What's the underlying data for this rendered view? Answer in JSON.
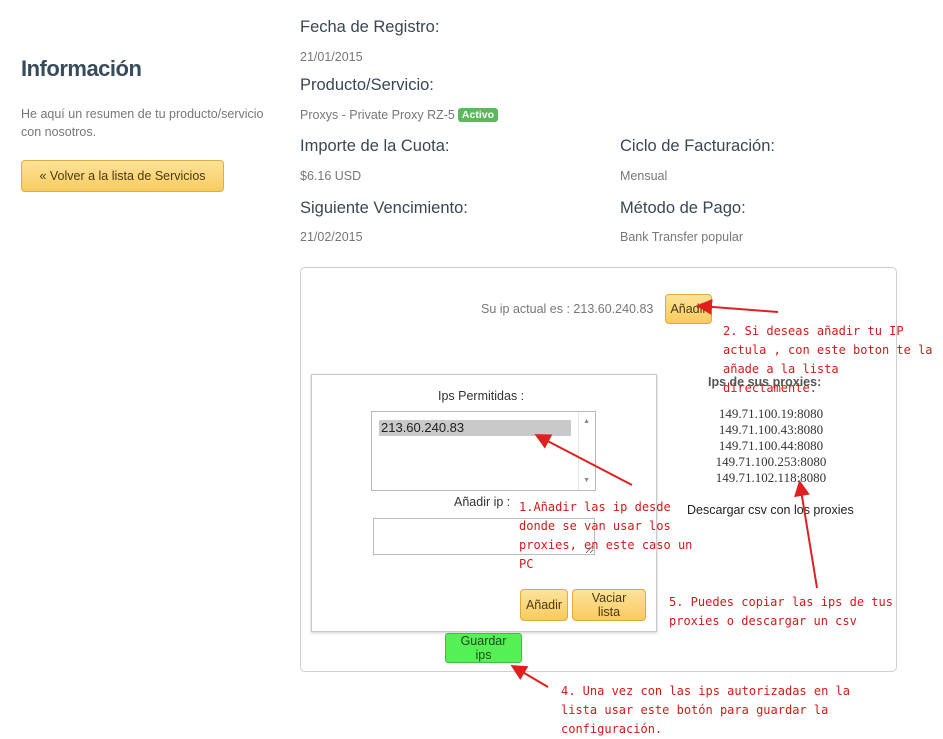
{
  "sidebar": {
    "title": "Información",
    "description": "He aquí un resumen de tu producto/servicio con nosotros.",
    "back_button": "« Volver a la lista de Servicios"
  },
  "info": {
    "registration_date_label": "Fecha de Registro:",
    "registration_date": "21/01/2015",
    "product_label": "Producto/Servicio:",
    "product_value": "Proxys - Private Proxy RZ-5",
    "status_badge": "Activo",
    "amount_label": "Importe de la Cuota:",
    "amount_value": "$6.16 USD",
    "billing_cycle_label": "Ciclo de Facturación:",
    "billing_cycle_value": "Mensual",
    "next_due_label": "Siguiente Vencimiento:",
    "next_due_value": "21/02/2015",
    "payment_method_label": "Método de Pago:",
    "payment_method_value": "Bank Transfer popular"
  },
  "panel": {
    "current_ip_text": "Su ip actual es : 213.60.240.83",
    "add_current_button": "Añadir",
    "allowed_ips_title": "Ips Permitidas :",
    "allowed_ips": [
      "213.60.240.83"
    ],
    "add_ip_label": "Añadir ip :",
    "add_ip_value": "",
    "add_button": "Añadir",
    "clear_button": "Vaciar lista",
    "save_button": "Guardar ips",
    "proxies_title": "Ips de sus proxies:",
    "proxies": [
      "149.71.100.19:8080",
      "149.71.100.43:8080",
      "149.71.100.44:8080",
      "149.71.100.253:8080",
      "149.71.102.118:8080"
    ],
    "csv_link": "Descargar csv con los proxies"
  },
  "annotations": {
    "note_2": "2. Si deseas añadir tu IP actula , con este boton te la añade a la lista directamente.",
    "note_1": "1.Añadir las ip desde donde se van usar los proxies, en este caso un PC",
    "note_5": "5. Puedes copiar las ips de tus proxies o descargar un csv",
    "note_4": "4. Una vez con las ips autorizadas en la lista usar este botón para guardar la configuración."
  },
  "colors": {
    "annotation": "#d11a1a",
    "badge": "#5cb85c",
    "save_button": "#55f055",
    "yellow_button": "#f8cb5f"
  }
}
